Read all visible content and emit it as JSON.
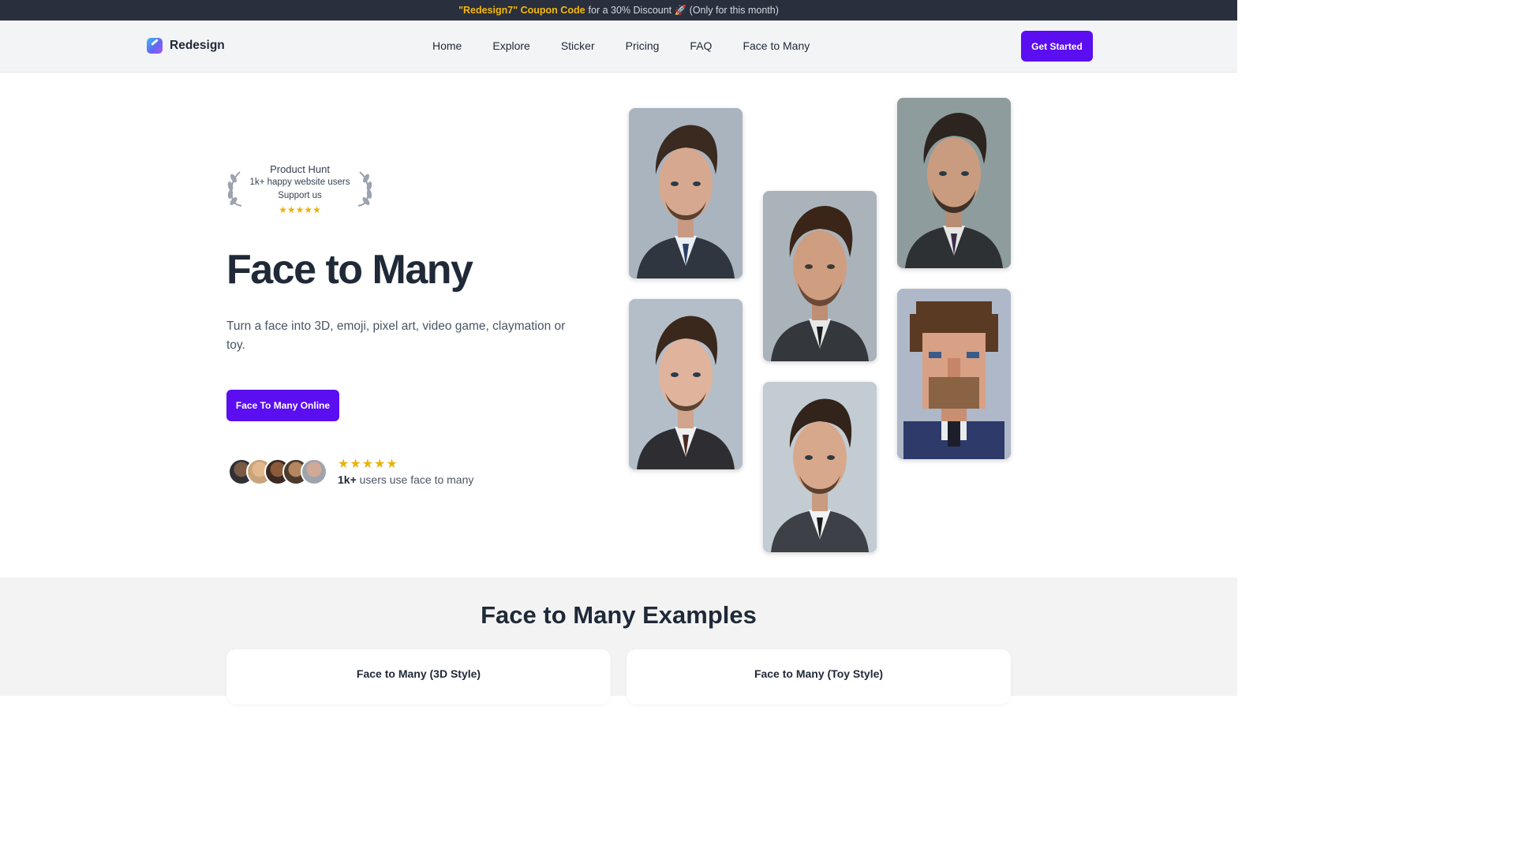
{
  "banner": {
    "code": "\"Redesign7\" Coupon Code",
    "text": "for a 30% Discount 🚀 (Only for this month)"
  },
  "header": {
    "logo_text": "Redesign",
    "nav": [
      "Home",
      "Explore",
      "Sticker",
      "Pricing",
      "FAQ",
      "Face to Many"
    ],
    "cta": "Get Started"
  },
  "award": {
    "title": "Product Hunt",
    "line1": "1k+ happy website users",
    "line2": "Support us",
    "stars": "★★★★★"
  },
  "hero": {
    "title": "Face to Many",
    "subtitle": "Turn a face into 3D, emoji, pixel art, video game, claymation or toy.",
    "button": "Face To Many Online"
  },
  "social_proof": {
    "stars": "★★★★★",
    "count": "1k+",
    "text": "users use face to many"
  },
  "examples": {
    "title": "Face to Many Examples",
    "cards": [
      "Face to Many (3D Style)",
      "Face to Many (Toy Style)"
    ]
  },
  "colors": {
    "accent": "#5b0ef0",
    "star": "#eab308",
    "coupon": "#f5b90b"
  },
  "icons": [
    "app-logo-icon",
    "laurel-left-icon",
    "laurel-right-icon",
    "star-icon"
  ]
}
